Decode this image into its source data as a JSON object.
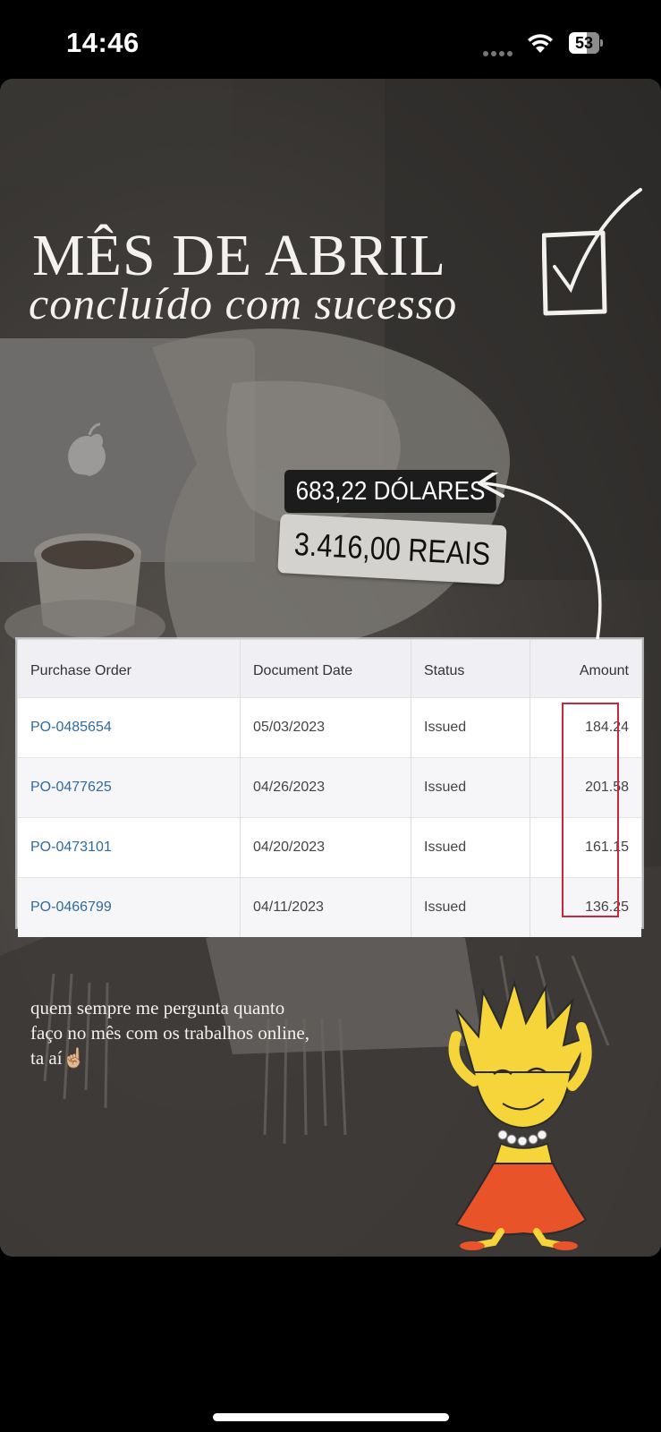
{
  "status_bar": {
    "time": "14:46",
    "battery": "53"
  },
  "story": {
    "title": "MÊS DE ABRIL",
    "subtitle": "concluído com sucesso",
    "dollars_tag": "683,22 DÓLARES",
    "reais_tag": "3.416,00 REAIS",
    "caption": "quem sempre me pergunta quanto faço no mês com os trabalhos online, ta aí☝🏼"
  },
  "table": {
    "headers": {
      "purchase_order": "Purchase Order",
      "document_date": "Document Date",
      "status": "Status",
      "amount": "Amount"
    },
    "rows": [
      {
        "po": "PO-0485654",
        "date": "05/03/2023",
        "status": "Issued",
        "amount": "184.24"
      },
      {
        "po": "PO-0477625",
        "date": "04/26/2023",
        "status": "Issued",
        "amount": "201.58"
      },
      {
        "po": "PO-0473101",
        "date": "04/20/2023",
        "status": "Issued",
        "amount": "161.15"
      },
      {
        "po": "PO-0466799",
        "date": "04/11/2023",
        "status": "Issued",
        "amount": "136.25"
      }
    ]
  },
  "colors": {
    "link": "#2f6aa0",
    "highlight_box": "#c8283d",
    "lisa_skin": "#f5d53a",
    "lisa_dress": "#e8532a"
  }
}
